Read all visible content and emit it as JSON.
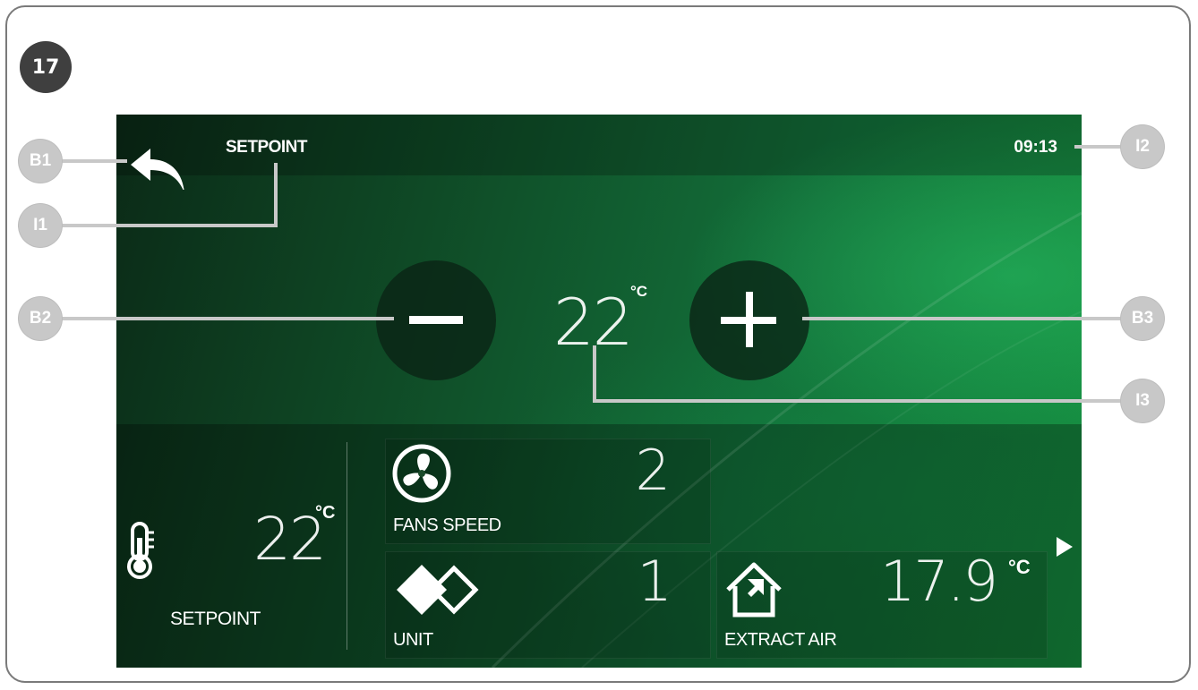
{
  "figure_number": "17",
  "header": {
    "title": "SETPOINT",
    "clock": "09:13"
  },
  "setpoint_control": {
    "value": "22",
    "unit": "°C",
    "decrease_icon": "minus-icon",
    "increase_icon": "plus-icon"
  },
  "status_panel": {
    "setpoint": {
      "value": "22",
      "unit": "°C",
      "label": "SETPOINT",
      "icon": "thermometer-icon"
    },
    "tiles": [
      {
        "label": "FANS SPEED",
        "value": "2",
        "icon": "fan-icon"
      },
      {
        "label": "UNIT",
        "value": "1",
        "icon": "unit-icon"
      },
      {
        "label": "EXTRACT AIR",
        "value": "17.9",
        "unit": "°C",
        "icon": "house-icon"
      }
    ],
    "next_icon": "arrow-right-icon"
  },
  "callouts": {
    "b1": "B1",
    "b2": "B2",
    "b3": "B3",
    "i1": "I1",
    "i2": "I2",
    "i3": "I3"
  },
  "colors": {
    "screen_green_dark": "#0b2a17",
    "screen_green_light": "#16903f",
    "callout_gray": "#c8c8c8",
    "badge_dark": "#3f3f3f"
  }
}
